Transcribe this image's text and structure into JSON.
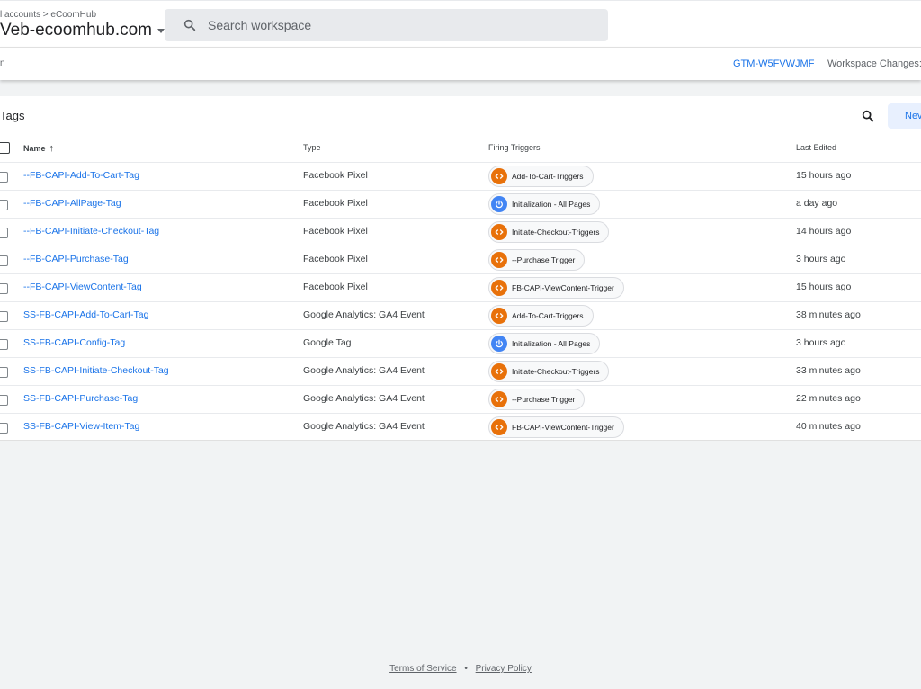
{
  "header": {
    "breadcrumb": "l accounts > eCoomHub",
    "container_name": "Veb-ecoomhub.com",
    "search_placeholder": "Search workspace"
  },
  "subbar": {
    "workspace_tab": "n",
    "container_id": "GTM-W5FVWJMF",
    "workspace_changes": "Workspace Changes:"
  },
  "tags": {
    "title": "Tags",
    "new_button": "Nev",
    "columns": {
      "name": "Name",
      "type": "Type",
      "firing_triggers": "Firing Triggers",
      "last_edited": "Last Edited"
    },
    "rows": [
      {
        "name": "--FB-CAPI-Add-To-Cart-Tag",
        "type": "Facebook Pixel",
        "trigger": "Add-To-Cart-Triggers",
        "trigger_icon": "code-icon",
        "edited": "15 hours ago"
      },
      {
        "name": "--FB-CAPI-AllPage-Tag",
        "type": "Facebook Pixel",
        "trigger": "Initialization - All Pages",
        "trigger_icon": "power-icon",
        "edited": "a day ago"
      },
      {
        "name": "--FB-CAPI-Initiate-Checkout-Tag",
        "type": "Facebook Pixel",
        "trigger": "Initiate-Checkout-Triggers",
        "trigger_icon": "code-icon",
        "edited": "14 hours ago"
      },
      {
        "name": "--FB-CAPI-Purchase-Tag",
        "type": "Facebook Pixel",
        "trigger": "--Purchase Trigger",
        "trigger_icon": "code-icon",
        "edited": "3 hours ago"
      },
      {
        "name": "--FB-CAPI-ViewContent-Tag",
        "type": "Facebook Pixel",
        "trigger": "FB-CAPI-ViewContent-Trigger",
        "trigger_icon": "code-icon",
        "edited": "15 hours ago"
      },
      {
        "name": "SS-FB-CAPI-Add-To-Cart-Tag",
        "type": "Google Analytics: GA4 Event",
        "trigger": "Add-To-Cart-Triggers",
        "trigger_icon": "code-icon",
        "edited": "38 minutes ago"
      },
      {
        "name": "SS-FB-CAPI-Config-Tag",
        "type": "Google Tag",
        "trigger": "Initialization - All Pages",
        "trigger_icon": "power-icon",
        "edited": "3 hours ago"
      },
      {
        "name": "SS-FB-CAPI-Initiate-Checkout-Tag",
        "type": "Google Analytics: GA4 Event",
        "trigger": "Initiate-Checkout-Triggers",
        "trigger_icon": "code-icon",
        "edited": "33 minutes ago"
      },
      {
        "name": "SS-FB-CAPI-Purchase-Tag",
        "type": "Google Analytics: GA4 Event",
        "trigger": "--Purchase Trigger",
        "trigger_icon": "code-icon",
        "edited": "22 minutes ago"
      },
      {
        "name": "SS-FB-CAPI-View-Item-Tag",
        "type": "Google Analytics: GA4 Event",
        "trigger": "FB-CAPI-ViewContent-Trigger",
        "trigger_icon": "code-icon",
        "edited": "40 minutes ago"
      }
    ]
  },
  "footer": {
    "terms": "Terms of Service",
    "separator": "•",
    "privacy": "Privacy Policy"
  },
  "colors": {
    "link": "#1a73e8",
    "trigger_code": "#e8710a",
    "trigger_power": "#4285f4"
  }
}
